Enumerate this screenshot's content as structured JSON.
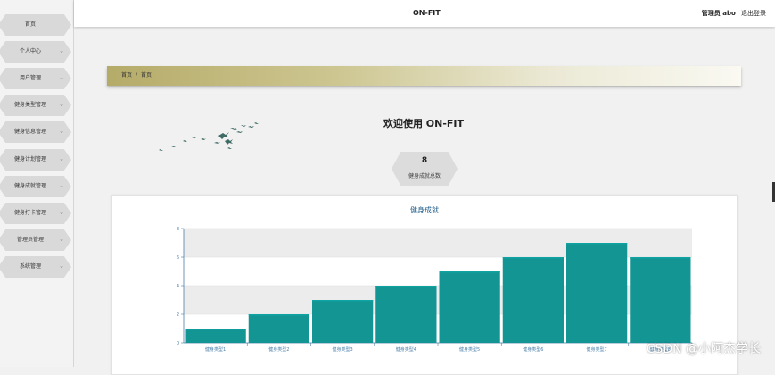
{
  "sidebar": {
    "items": [
      {
        "label": "首页",
        "has_submenu": false
      },
      {
        "label": "个人中心",
        "has_submenu": true
      },
      {
        "label": "用户管理",
        "has_submenu": true
      },
      {
        "label": "健身类型管理",
        "has_submenu": true
      },
      {
        "label": "健身信息管理",
        "has_submenu": true
      },
      {
        "label": "健身计划管理",
        "has_submenu": true
      },
      {
        "label": "健身成就管理",
        "has_submenu": true
      },
      {
        "label": "健身打卡管理",
        "has_submenu": true
      },
      {
        "label": "管理员管理",
        "has_submenu": true
      },
      {
        "label": "系统管理",
        "has_submenu": true
      }
    ]
  },
  "header": {
    "title": "ON-FIT",
    "user": "管理员 abo",
    "logout": "退出登录"
  },
  "breadcrumb": {
    "home": "首页",
    "separator": "/",
    "current": "首页"
  },
  "main": {
    "welcome": "欢迎使用 ON-FIT",
    "stat": {
      "value": "8",
      "label": "健身成就总数"
    }
  },
  "chart_data": {
    "type": "bar",
    "title": "健身成就",
    "categories": [
      "健身类型1",
      "健身类型2",
      "健身类型3",
      "健身类型4",
      "健身类型5",
      "健身类型6",
      "健身类型7",
      "健身类型8"
    ],
    "values": [
      1,
      2,
      3,
      4,
      5,
      6,
      7,
      6
    ],
    "ylim": [
      0,
      8
    ],
    "yticks": [
      0,
      2,
      4,
      6,
      8
    ],
    "xlabel": "",
    "ylabel": "",
    "grid": true,
    "colors": {
      "bar": "#139594",
      "bar_light": "#0fa4a2",
      "band": "#ececec",
      "axis": "#4a7fa8"
    }
  },
  "watermark": "CSDN @小阿杰学长",
  "colors": {
    "accent": "#b5ab69",
    "bar": "#139594"
  }
}
